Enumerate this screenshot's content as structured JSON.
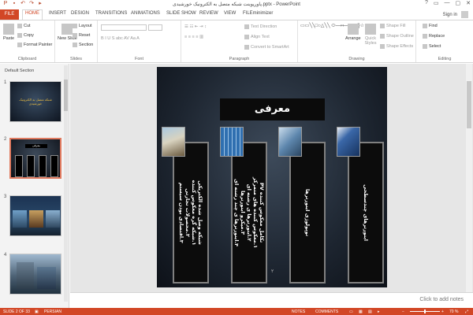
{
  "window": {
    "title": "پاورپوینت شبکه متصل به الکترونیک خورشیدی.pptx - PowerPoint",
    "controls": [
      "?",
      "▭",
      "—",
      "▢",
      "✕"
    ]
  },
  "tabs": [
    "FILE",
    "HOME",
    "INSERT",
    "DESIGN",
    "TRANSITIONS",
    "ANIMATIONS",
    "SLIDE SHOW",
    "REVIEW",
    "VIEW",
    "FILEminimizer"
  ],
  "account": {
    "signin": "Sign in"
  },
  "ribbon": {
    "clipboard": {
      "paste": "Paste",
      "cut": "Cut",
      "copy": "Copy",
      "format_painter": "Format Painter",
      "label": "Clipboard"
    },
    "slides": {
      "new_slide": "New Slide",
      "layout": "Layout",
      "reset": "Reset",
      "section": "Section",
      "label": "Slides"
    },
    "font": {
      "label": "Font"
    },
    "paragraph": {
      "text_direction": "Text Direction",
      "align_text": "Align Text",
      "convert": "Convert to SmartArt",
      "label": "Paragraph"
    },
    "drawing": {
      "arrange": "Arrange",
      "quick_styles": "Quick Styles",
      "shape_fill": "Shape Fill",
      "shape_outline": "Shape Outline",
      "shape_effects": "Shape Effects",
      "label": "Drawing"
    },
    "editing": {
      "find": "Find",
      "replace": "Replace",
      "select": "Select",
      "label": "Editing"
    }
  },
  "slides_pane": {
    "section": "Default Section",
    "thumbnails": [
      {
        "num": "1",
        "caption": "شبکه متصل به الکترونیک خورشیدی"
      },
      {
        "num": "2",
        "caption": "معرفی"
      },
      {
        "num": "3",
        "caption": ""
      },
      {
        "num": "4",
        "caption": ""
      }
    ]
  },
  "slide": {
    "title": "معرفی",
    "number": "۲",
    "columns": [
      {
        "text": "شبکه وصل شده الکتریکی\n۱.شبکه گره معکوس کننده\n۲.محصولات تجارتی\n۳.اقتصادی بودن سیستم"
      },
      {
        "text": "تکامل معکوس کننده PV\n۱.معکوس کننده های متمرکز\n۲.اینورترها ی رشته ای\n۳.میکرو اینورترها\n۴.اینورترها ی چند رشته ای"
      },
      {
        "text": "توپولوژی اینورترها"
      },
      {
        "text": "اینورترهای چندسطحی"
      }
    ]
  },
  "notes": {
    "placeholder": "Click to add notes"
  },
  "status": {
    "slide": "SLIDE 2 OF 33",
    "language": "PERSIAN",
    "notes": "NOTES",
    "comments": "COMMENTS",
    "zoom": "70 %"
  },
  "colors": {
    "accent": "#d24726",
    "slide_column": "#0c0c0c"
  }
}
